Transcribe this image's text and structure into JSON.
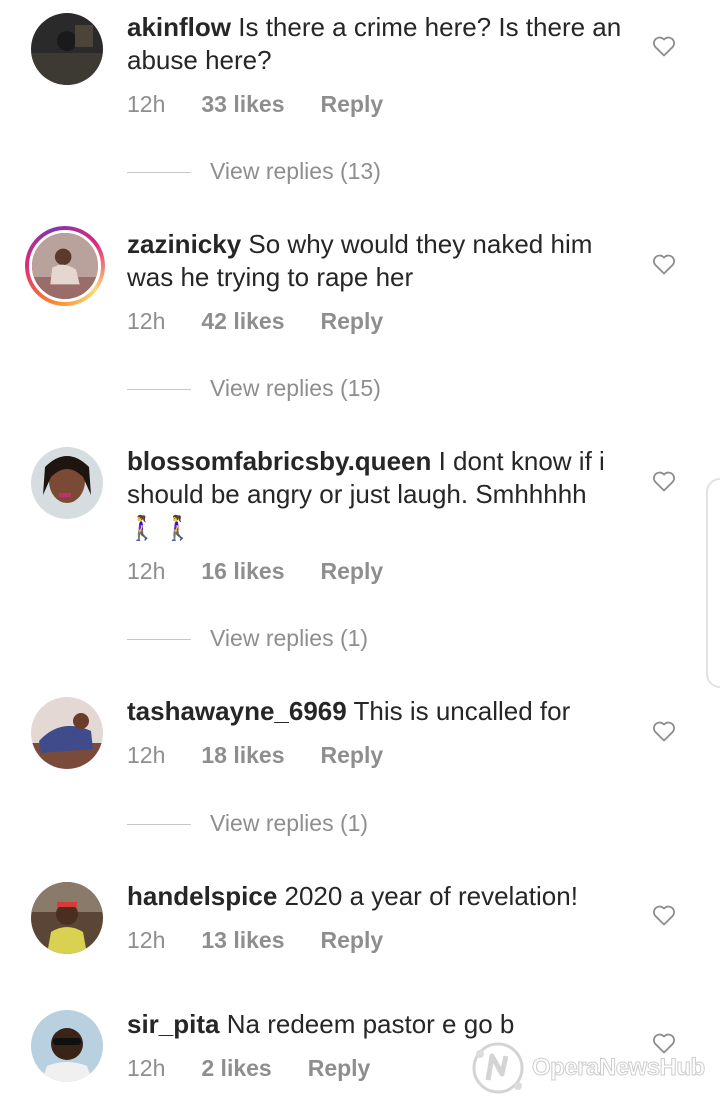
{
  "comments": [
    {
      "username": "akinflow",
      "text": "Is there a crime here? Is there an abuse here?",
      "time": "12h",
      "likes": "33 likes",
      "reply": "Reply",
      "view_replies": "View replies (13)"
    },
    {
      "username": "zazinicky",
      "text": "So why would they naked him was he trying to rape her",
      "time": "12h",
      "likes": "42 likes",
      "reply": "Reply",
      "view_replies": "View replies (15)"
    },
    {
      "username": "blossomfabricsby.queen",
      "text": "I dont know if i should be angry or just laugh. Smhhhhh",
      "emoji": "🚶‍♀️🚶‍♀️",
      "time": "12h",
      "likes": "16 likes",
      "reply": "Reply",
      "view_replies": "View replies (1)"
    },
    {
      "username": "tashawayne_6969",
      "text": "This is uncalled for",
      "time": "12h",
      "likes": "18 likes",
      "reply": "Reply",
      "view_replies": "View replies (1)"
    },
    {
      "username": "handelspice",
      "text": "2020 a year of revelation!",
      "time": "12h",
      "likes": "13 likes",
      "reply": "Reply"
    },
    {
      "username": "sir_pita",
      "text": "Na redeem pastor e go b",
      "time": "12h",
      "likes": "2 likes",
      "reply": "Reply"
    }
  ],
  "watermark": {
    "text": "OperaNewsHub",
    "icon": "opera-news-logo-icon"
  },
  "colors": {
    "text": "#262626",
    "meta": "#8e8e8e",
    "divider": "#c7c7c7"
  }
}
